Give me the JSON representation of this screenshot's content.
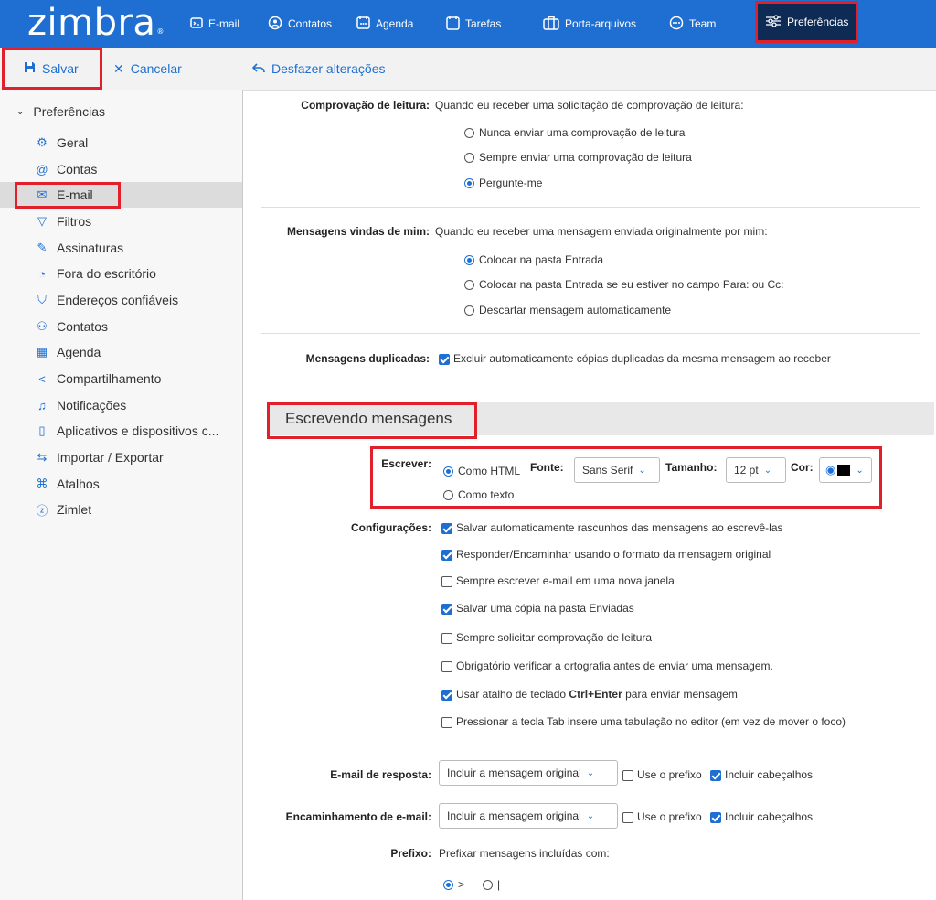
{
  "app": {
    "logo": "zimbra",
    "logo_mark": "®"
  },
  "nav": [
    {
      "label": "E-mail",
      "icon": "mail-icon"
    },
    {
      "label": "Contatos",
      "icon": "contacts-icon"
    },
    {
      "label": "Agenda",
      "icon": "calendar-icon"
    },
    {
      "label": "Tarefas",
      "icon": "tasks-icon"
    },
    {
      "label": "Porta-arquivos",
      "icon": "briefcase-icon"
    },
    {
      "label": "Team",
      "icon": "team-icon"
    },
    {
      "label": "Preferências",
      "icon": "settings-sliders-icon"
    }
  ],
  "toolbar": {
    "save": "Salvar",
    "cancel": "Cancelar",
    "undo": "Desfazer alterações"
  },
  "sidebar": {
    "header": "Preferências",
    "items": [
      {
        "label": "Geral"
      },
      {
        "label": "Contas"
      },
      {
        "label": "E-mail"
      },
      {
        "label": "Filtros"
      },
      {
        "label": "Assinaturas"
      },
      {
        "label": "Fora do escritório"
      },
      {
        "label": "Endereços confiáveis"
      },
      {
        "label": "Contatos"
      },
      {
        "label": "Agenda"
      },
      {
        "label": "Compartilhamento"
      },
      {
        "label": "Notificações"
      },
      {
        "label": "Aplicativos e dispositivos c..."
      },
      {
        "label": "Importar / Exportar"
      },
      {
        "label": "Atalhos"
      },
      {
        "label": "Zimlet"
      }
    ]
  },
  "read_receipt": {
    "label": "Comprovação de leitura:",
    "desc": "Quando eu receber uma solicitação de comprovação de leitura:",
    "options": [
      "Nunca enviar uma comprovação de leitura",
      "Sempre enviar uma comprovação de leitura",
      "Pergunte-me"
    ],
    "selected": 2
  },
  "from_me": {
    "label": "Mensagens vindas de mim:",
    "desc": "Quando eu receber uma mensagem enviada originalmente por mim:",
    "options": [
      "Colocar na pasta Entrada",
      "Colocar na pasta Entrada se eu estiver no campo Para: ou Cc:",
      "Descartar mensagem automaticamente"
    ],
    "selected": 0
  },
  "duplicates": {
    "label": "Mensagens duplicadas:",
    "text": "Excluir automaticamente cópias duplicadas da mesma mensagem ao receber",
    "checked": true
  },
  "compose": {
    "section_title": "Escrevendo mensagens",
    "write_label": "Escrever:",
    "html_option": "Como HTML",
    "text_option": "Como texto",
    "font_label": "Fonte:",
    "font_value": "Sans Serif",
    "size_label": "Tamanho:",
    "size_value": "12 pt",
    "color_label": "Cor:",
    "color_value": "#000000"
  },
  "config": {
    "label": "Configurações:",
    "items": [
      {
        "text": "Salvar automaticamente rascunhos das mensagens ao escrevê-las",
        "checked": true
      },
      {
        "text": "Responder/Encaminhar usando o formato da mensagem original",
        "checked": true
      },
      {
        "text": "Sempre escrever e-mail em uma nova janela",
        "checked": false
      },
      {
        "text": "Salvar uma cópia na pasta Enviadas",
        "checked": true
      },
      {
        "text": "Sempre solicitar comprovação de leitura",
        "checked": false
      },
      {
        "text": "Obrigatório verificar a ortografia antes de enviar uma mensagem.",
        "checked": false
      },
      {
        "text_pre": "Usar atalho de teclado ",
        "text_bold": "Ctrl+Enter",
        "text_post": " para enviar mensagem",
        "checked": true
      },
      {
        "text": "Pressionar a tecla Tab insere uma tabulação no editor (em vez de mover o foco)",
        "checked": false
      }
    ]
  },
  "reply": {
    "label": "E-mail de resposta:",
    "select": "Incluir a mensagem original",
    "prefix": "Use o prefixo",
    "prefix_checked": false,
    "headers": "Incluir cabeçalhos",
    "headers_checked": true
  },
  "forward": {
    "label": "Encaminhamento de e-mail:",
    "select": "Incluir a mensagem original",
    "prefix": "Use o prefixo",
    "prefix_checked": false,
    "headers": "Incluir cabeçalhos",
    "headers_checked": true
  },
  "prefix": {
    "label": "Prefixo:",
    "desc": "Prefixar mensagens incluídas com:",
    "opt1": ">",
    "opt2": "|",
    "selected": 0
  }
}
